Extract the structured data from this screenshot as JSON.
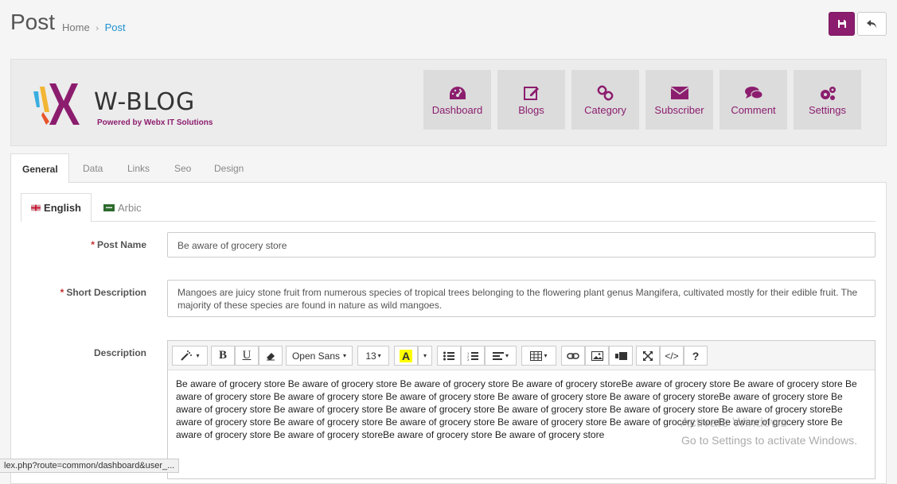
{
  "page": {
    "title": "Post"
  },
  "breadcrumb": {
    "home": "Home",
    "separator": "›",
    "current": "Post"
  },
  "header": {
    "logo_text": "W-BLOG",
    "logo_subtitle": "Powered by Webx IT Solutions",
    "nav": [
      {
        "label": "Dashboard",
        "icon": "dashboard-icon"
      },
      {
        "label": "Blogs",
        "icon": "edit-icon"
      },
      {
        "label": "Category",
        "icon": "link-icon"
      },
      {
        "label": "Subscriber",
        "icon": "envelope-icon"
      },
      {
        "label": "Comment",
        "icon": "comments-icon"
      },
      {
        "label": "Settings",
        "icon": "gears-icon"
      }
    ]
  },
  "tabs": [
    "General",
    "Data",
    "Links",
    "Seo",
    "Design"
  ],
  "lang_tabs": [
    "English",
    "Arbic"
  ],
  "form": {
    "post_name_label": "Post Name",
    "post_name_value": "Be aware of grocery store",
    "short_desc_label": "Short Description",
    "short_desc_value": "Mangoes are juicy stone fruit from numerous species of tropical trees belonging to the flowering plant genus Mangifera, cultivated mostly for their edible fruit. The majority of these species are found in nature as wild mangoes.",
    "description_label": "Description",
    "description_value": "Be aware of grocery store Be aware of grocery store Be aware of grocery store Be aware of grocery storeBe aware of grocery store Be aware of grocery store Be aware of grocery store Be aware of grocery store Be aware of grocery store Be aware of grocery store Be aware of grocery storeBe aware of grocery store Be aware of grocery store Be aware of grocery store Be aware of grocery store Be aware of grocery store Be aware of grocery store Be aware of grocery storeBe aware of grocery store Be aware of grocery store Be aware of grocery store Be aware of grocery store Be aware of grocery storeBe aware of grocery store Be aware of grocery store Be aware of grocery storeBe aware of grocery store Be aware of grocery store"
  },
  "toolbar": {
    "font_name": "Open Sans",
    "font_size": "13",
    "bold": "B",
    "underline": "U",
    "color_letter": "A",
    "code": "</>",
    "help": "?"
  },
  "status_url": "lex.php?route=common/dashboard&user_...",
  "watermark": {
    "line1": "Activate Windows",
    "line2": "Go to Settings to activate Windows."
  },
  "colors": {
    "brand": "#8c1d6e",
    "link": "#1e91cf"
  }
}
